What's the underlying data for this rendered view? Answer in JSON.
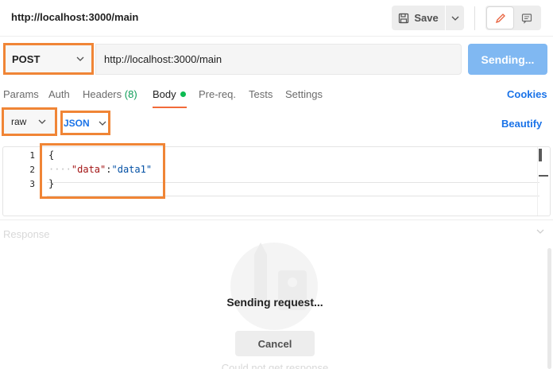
{
  "header": {
    "title": "http://localhost:3000/main",
    "save_label": "Save",
    "save_icon": "floppy-disk-icon",
    "toggle_edit_icon": "pencil-icon",
    "toggle_comment_icon": "comment-icon"
  },
  "request": {
    "method": "POST",
    "url": "http://localhost:3000/main",
    "send_label": "Sending..."
  },
  "tabs": [
    {
      "label": "Params"
    },
    {
      "label": "Auth"
    },
    {
      "label": "Headers",
      "count": "(8)"
    },
    {
      "label": "Body",
      "active": true
    },
    {
      "label": "Pre-req."
    },
    {
      "label": "Tests"
    },
    {
      "label": "Settings"
    }
  ],
  "cookies_label": "Cookies",
  "body": {
    "mode": "raw",
    "language": "JSON",
    "beautify_label": "Beautify",
    "lines": [
      {
        "num": "1",
        "text": "{"
      },
      {
        "num": "2",
        "indent": "····",
        "key": "\"data\"",
        "colon": ":",
        "value": "\"data1\""
      },
      {
        "num": "3",
        "text": "}"
      }
    ]
  },
  "response": {
    "label": "Response",
    "status": "Sending request...",
    "cancel_label": "Cancel",
    "empty_text": "Could not get response"
  },
  "colors": {
    "highlight": "#f08536",
    "send_button": "#80b8f2",
    "link": "#1a73e8",
    "active_tab_underline": "#f26b3a",
    "body_dot": "#0cbb52"
  }
}
